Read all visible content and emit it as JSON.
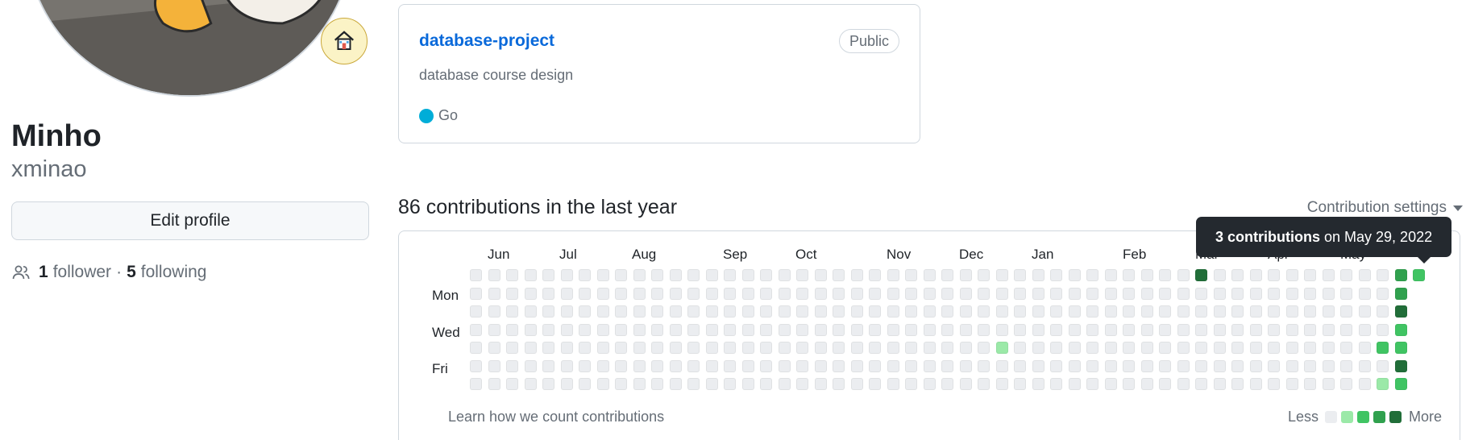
{
  "profile": {
    "name": "Minho",
    "login": "xminao",
    "edit_button_label": "Edit profile",
    "status_icon": "house-icon",
    "followers_count": "1",
    "followers_label": "follower",
    "separator": "·",
    "following_count": "5",
    "following_label": "following"
  },
  "repo": {
    "name": "database-project",
    "visibility": "Public",
    "description": "database course design",
    "language": "Go",
    "language_color": "#00add8"
  },
  "contributions": {
    "title": "86 contributions in the last year",
    "settings_label": "Contribution settings",
    "months": [
      "Jun",
      "Jul",
      "Aug",
      "Sep",
      "Oct",
      "Nov",
      "Dec",
      "Jan",
      "Feb",
      "Mar",
      "Apr",
      "May"
    ],
    "day_labels": [
      "Mon",
      "Wed",
      "Fri"
    ],
    "learn_link": "Learn how we count contributions",
    "legend_less": "Less",
    "legend_more": "More",
    "colors": [
      "#ebedf0",
      "#9be9a8",
      "#40c463",
      "#30a14e",
      "#216e39"
    ],
    "weeks": 53,
    "active_cells": [
      {
        "week": 40,
        "day": 0,
        "level": 4
      },
      {
        "week": 29,
        "day": 4,
        "level": 1
      },
      {
        "week": 50,
        "day": 4,
        "level": 2
      },
      {
        "week": 50,
        "day": 6,
        "level": 1
      },
      {
        "week": 51,
        "day": 0,
        "level": 3
      },
      {
        "week": 51,
        "day": 1,
        "level": 3
      },
      {
        "week": 51,
        "day": 2,
        "level": 4
      },
      {
        "week": 51,
        "day": 3,
        "level": 2
      },
      {
        "week": 51,
        "day": 4,
        "level": 2
      },
      {
        "week": 51,
        "day": 5,
        "level": 4
      },
      {
        "week": 51,
        "day": 6,
        "level": 2
      },
      {
        "week": 52,
        "day": 0,
        "level": 2
      }
    ]
  },
  "tooltip": {
    "count_text": "3 contributions",
    "date_text": "on May 29, 2022"
  }
}
